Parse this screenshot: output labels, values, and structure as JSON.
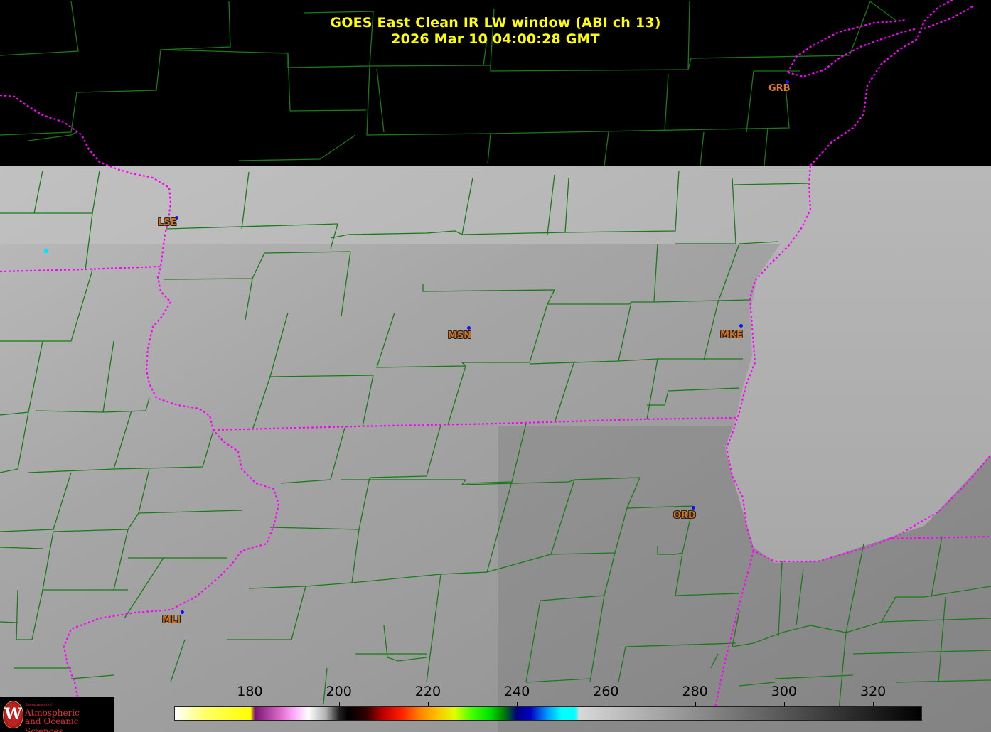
{
  "title": {
    "line1": "GOES East Clean IR LW window (ABI ch 13)",
    "line2": "2026 Mar 10  04:00:28 GMT"
  },
  "stations": [
    {
      "id": "GRB",
      "style": "plain"
    },
    {
      "id": "LSE",
      "style": "outlined"
    },
    {
      "id": "MSN",
      "style": "outlined"
    },
    {
      "id": "MKE",
      "style": "outlined"
    },
    {
      "id": "ORD",
      "style": "outlined"
    },
    {
      "id": "MLI",
      "style": "outlined"
    }
  ],
  "colorbar": {
    "min": 163,
    "max": 331,
    "ticks": [
      "180",
      "200",
      "220",
      "240",
      "260",
      "280",
      "300",
      "320"
    ],
    "stops": [
      {
        "value": 163,
        "color": "#ffffff"
      },
      {
        "value": 170,
        "color": "#ffff66"
      },
      {
        "value": 180,
        "color": "#ffff00"
      },
      {
        "value": 181,
        "color": "#7a1470"
      },
      {
        "value": 187,
        "color": "#e070d0"
      },
      {
        "value": 190,
        "color": "#ffb0ff"
      },
      {
        "value": 193,
        "color": "#ffffff"
      },
      {
        "value": 197,
        "color": "#b0b0b0"
      },
      {
        "value": 200,
        "color": "#202020"
      },
      {
        "value": 202,
        "color": "#000000"
      },
      {
        "value": 206,
        "color": "#300000"
      },
      {
        "value": 210,
        "color": "#c00000"
      },
      {
        "value": 214,
        "color": "#ff2000"
      },
      {
        "value": 218,
        "color": "#ff8000"
      },
      {
        "value": 222,
        "color": "#ffc000"
      },
      {
        "value": 226,
        "color": "#e0ff00"
      },
      {
        "value": 230,
        "color": "#40ff00"
      },
      {
        "value": 234,
        "color": "#00e000"
      },
      {
        "value": 237,
        "color": "#008000"
      },
      {
        "value": 240,
        "color": "#000080"
      },
      {
        "value": 243,
        "color": "#0000c0"
      },
      {
        "value": 247,
        "color": "#00a0ff"
      },
      {
        "value": 250,
        "color": "#00ffff"
      },
      {
        "value": 253,
        "color": "#00ffff"
      },
      {
        "value": 254,
        "color": "#d8d8d8"
      },
      {
        "value": 331,
        "color": "#000000"
      }
    ]
  },
  "colors": {
    "county_lines": "#1a7a1a",
    "state_lines": "#ff00ff",
    "title": "#ffff00",
    "station_label": "#e07a2a",
    "station_dot": "#1010ff"
  },
  "logo": {
    "seal_letter": "W",
    "dept": "Department of",
    "line1": "Atmospheric",
    "line2": "and Oceanic Sciences"
  }
}
